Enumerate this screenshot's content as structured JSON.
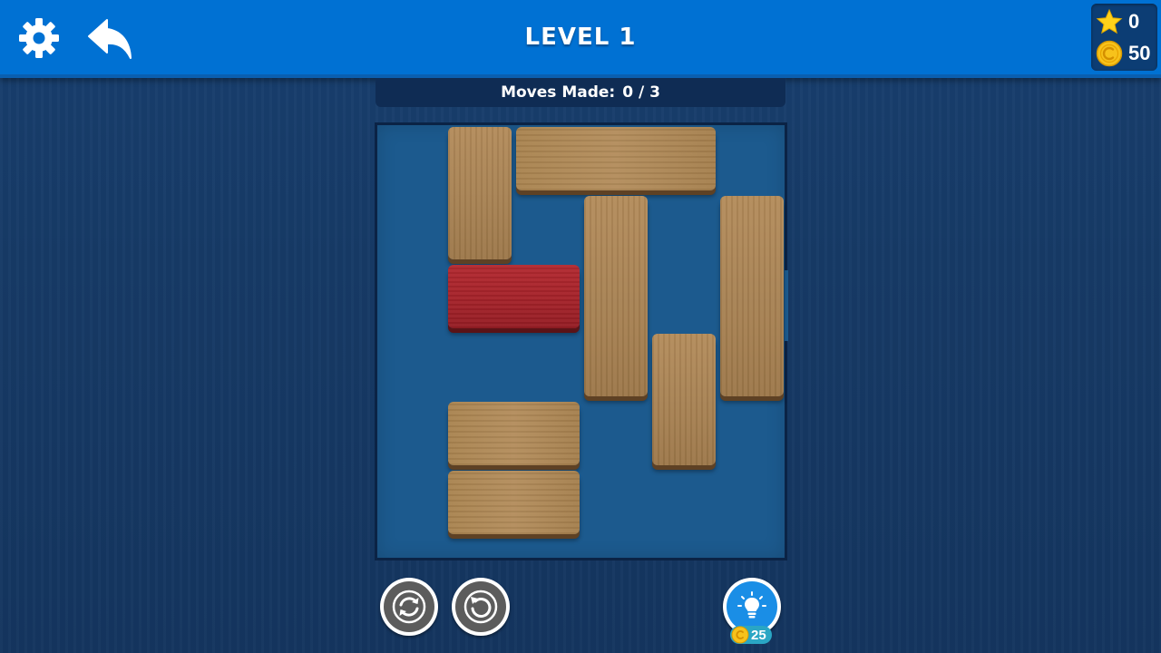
{
  "header": {
    "level_title": "LEVEL 1",
    "settings_icon": "gear-icon",
    "back_icon": "back-arrow-icon",
    "stars": "0",
    "coins": "50"
  },
  "moves": {
    "label": "Moves Made:",
    "value": "0 / 3"
  },
  "board": {
    "grid_columns": 6,
    "grid_rows": 6,
    "exit_row": 3,
    "exit_side": "right",
    "blocks": [
      {
        "id": "wood-1",
        "color": "wood",
        "orientation": "vertical",
        "col": 2,
        "row": 1,
        "length": 2
      },
      {
        "id": "wood-2",
        "color": "wood",
        "orientation": "horizontal",
        "col": 3,
        "row": 1,
        "length": 3
      },
      {
        "id": "wood-3",
        "color": "wood",
        "orientation": "vertical",
        "col": 4,
        "row": 2,
        "length": 3
      },
      {
        "id": "wood-4",
        "color": "wood",
        "orientation": "vertical",
        "col": 6,
        "row": 2,
        "length": 3
      },
      {
        "id": "target",
        "color": "red",
        "orientation": "horizontal",
        "col": 2,
        "row": 3,
        "length": 2
      },
      {
        "id": "wood-5",
        "color": "wood",
        "orientation": "vertical",
        "col": 5,
        "row": 4,
        "length": 2
      },
      {
        "id": "wood-6",
        "color": "wood",
        "orientation": "horizontal",
        "col": 2,
        "row": 5,
        "length": 2
      },
      {
        "id": "wood-7",
        "color": "wood",
        "orientation": "horizontal",
        "col": 2,
        "row": 6,
        "length": 2
      }
    ]
  },
  "controls": {
    "restart_icon": "restart-icon",
    "undo_icon": "undo-icon",
    "hint_icon": "lightbulb-icon",
    "hint_cost": "25"
  },
  "colors": {
    "topbar": "#0071d3",
    "background": "#163a66",
    "board": "#1c5a8e",
    "wood": "#a88253",
    "target_block": "#a6232a",
    "star": "#ffd21a",
    "coin": "#f7c21b"
  }
}
